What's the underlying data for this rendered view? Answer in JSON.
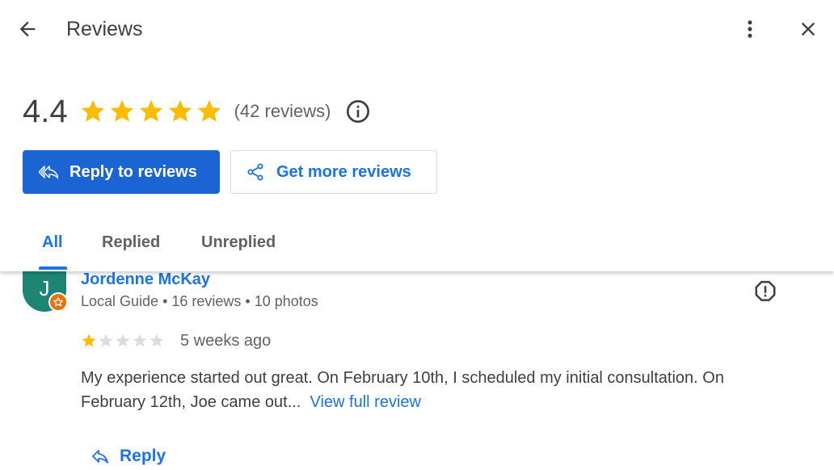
{
  "header": {
    "title": "Reviews",
    "back_icon": "arrow-back-icon",
    "more_icon": "more-vert-icon",
    "close_icon": "close-icon"
  },
  "summary": {
    "rating": "4.4",
    "stars_filled": 5,
    "review_count_text": "(42 reviews)",
    "info_icon": "info-icon",
    "star_color": "#fbbc04"
  },
  "actions": {
    "reply_label": "Reply to reviews",
    "get_more_label": "Get more reviews",
    "primary_color": "#1a64d3",
    "accent_color": "#1a73e8"
  },
  "tabs": [
    {
      "label": "All",
      "active": true
    },
    {
      "label": "Replied",
      "active": false
    },
    {
      "label": "Unreplied",
      "active": false
    }
  ],
  "review": {
    "avatar_letter": "J",
    "avatar_color": "#1e8574",
    "badge_icon": "local-guide-star-icon",
    "name": "Jordenne McKay",
    "meta": "Local Guide • 16 reviews • 10 photos",
    "rating": 1,
    "max_rating": 5,
    "date": "5 weeks ago",
    "text": "My experience started out great. On February 10th, I scheduled my initial consultation. On February 12th, Joe came out...",
    "view_full_label": "View full review",
    "reply_label": "Reply",
    "flag_icon": "report-icon"
  }
}
